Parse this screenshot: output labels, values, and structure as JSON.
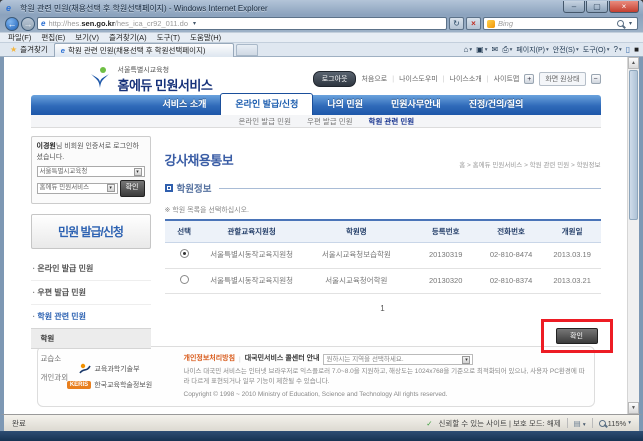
{
  "icons": {
    "back": "←",
    "forward": "→",
    "dropdown": "▾",
    "refresh": "↻",
    "stop": "×",
    "star": "★",
    "home": "⌂",
    "mail": "✉",
    "help": "?",
    "check": "✓",
    "minimize": "–",
    "maximize": "▢",
    "close": "×",
    "up": "▲",
    "down": "▼",
    "ie": "e",
    "plus": "+",
    "minus": "−"
  },
  "window": {
    "title": "학원 관련 민원(채용선택 후 학원선택페이지) - Windows Internet Explorer",
    "url_prefix": "http://hes.",
    "url_domain": "sen.go.kr",
    "url_path": "/hes_ica_cr92_011.do",
    "search_placeholder": "Bing",
    "menu_items": [
      "파일(F)",
      "편집(E)",
      "보기(V)",
      "즐겨찾기(A)",
      "도구(T)",
      "도움말(H)"
    ],
    "favorites_label": "즐겨찾기",
    "tab_title": "학원 관련 민원(채용선택 후 학원선택페이지)",
    "cmd_page": "페이지(P)",
    "cmd_safety": "안전(S)",
    "cmd_tools": "도구(O)"
  },
  "header": {
    "org_name": "서울특별시교육청",
    "service_name": "홈에듀 민원서비스",
    "logout_label": "로그아웃",
    "links": [
      "처음으로",
      "나이스도우미",
      "나이스소개",
      "사이트맵"
    ],
    "screen_label": "화면 원상태"
  },
  "nav": {
    "items": [
      "서비스 소개",
      "온라인 발급/신청",
      "나의 민원",
      "민원사무안내",
      "진정/건의/질의"
    ],
    "sub": [
      "온라인 발급 민원",
      "우편 발급 민원",
      "학원 관련 민원"
    ]
  },
  "sidebar": {
    "login_name": "이경원",
    "login_rest": "님 비회원 인증서로 로그인하셨습니다.",
    "select_office": "서울특별시교육청",
    "select_service": "홈에듀 민원서비스",
    "confirm_label": "확인",
    "section_title": "민원 발급/신청",
    "menu": [
      "온라인 발급 민원",
      "우편 발급 민원",
      "학원 관련 민원"
    ],
    "submenu": [
      "학원",
      "교습소",
      "개인과외"
    ]
  },
  "main": {
    "page_title": "강사채용통보",
    "breadcrumb": "홈 > 홈에듀 민원서비스 > 학원 관련 민원 > 학원정보",
    "section_title": "학원정보",
    "note": "※ 학원 목록을 선택하십시오.",
    "table": {
      "headers": [
        "선택",
        "관할교육지원청",
        "학원명",
        "등록번호",
        "전화번호",
        "개원일"
      ],
      "rows": [
        {
          "selected": true,
          "office": "서울특별시동작교육지원청",
          "name": "서울시교육청보습학원",
          "reg_no": "20130319",
          "phone": "02-810-8474",
          "open_date": "2013.03.19"
        },
        {
          "selected": false,
          "office": "서울특별시동작교육지원청",
          "name": "서울시교육청어학원",
          "reg_no": "20130320",
          "phone": "02-810-8374",
          "open_date": "2013.03.21"
        }
      ]
    },
    "pagination": "1",
    "confirm_label": "확인"
  },
  "footer": {
    "ministry": "교육과학기술부",
    "keris_badge": "KERIS",
    "keris_name": "한국교육학술정보원",
    "privacy": "개인정보처리방침",
    "callcenter": "대국민서비스 콜센터 안내",
    "region_placeholder": "원하시는 지역을 선택하세요.",
    "notice": "나이스 대국민 서비스는 인터넷 브라우저로 익스플로러 7.0~8.0을 지원하고, 해상도는 1024x768을 기준으로 최적화되어 있으나, 사용자 PC환경에 따라 다르게 표현되거나 일부 기능이 제한될 수 있습니다.",
    "copyright": "Copyright © 1998 ~ 2010 Ministry of Education, Science and Technology All rights reserved."
  },
  "statusbar": {
    "done": "완료",
    "trusted": "신뢰할 수 있는 사이트 | 보호 모드: 해제",
    "zoom": "115%"
  },
  "colors": {
    "accent_blue": "#2f6ab9",
    "highlight_red": "#ed1c24",
    "logout_dark": "#2e3640"
  }
}
